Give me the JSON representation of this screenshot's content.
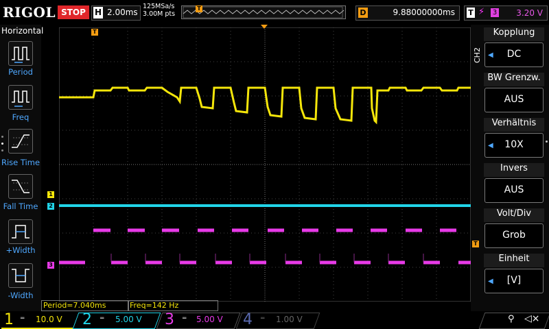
{
  "topbar": {
    "brand": "RIGOL",
    "run_status": "STOP",
    "horizontal_key": "H",
    "timebase": "2.00ms",
    "sample_rate": "125MSa/s",
    "memory_depth": "3.00M pts",
    "delay_key": "D",
    "delay": "9.88000000ms",
    "trigger_key": "T",
    "trigger_source": "3",
    "trigger_level": "3.20 V"
  },
  "left_panel": {
    "title": "Horizontal",
    "items": [
      {
        "label": "Period"
      },
      {
        "label": "Freq"
      },
      {
        "label": "Rise Time"
      },
      {
        "label": "Fall Time"
      },
      {
        "label": "+Width"
      },
      {
        "label": "-Width"
      }
    ]
  },
  "right_panel": {
    "channel_tag": "CH2",
    "items": [
      {
        "title": "Kopplung",
        "value": "DC"
      },
      {
        "title": "BW Grenzw.",
        "value": "AUS"
      },
      {
        "title": "Verhältnis",
        "value": "10X"
      },
      {
        "title": "Invers",
        "value": "AUS"
      },
      {
        "title": "Volt/Div",
        "value": "Grob"
      },
      {
        "title": "Einheit",
        "value": "[V]"
      }
    ]
  },
  "measurements": {
    "period": "Period=7.040ms",
    "freq": "Freq=142 Hz"
  },
  "channels": [
    {
      "num": "1",
      "scale": "10.0 V",
      "color": "#f5e60a"
    },
    {
      "num": "2",
      "scale": "5.00 V",
      "color": "#21d4e8"
    },
    {
      "num": "3",
      "scale": "5.00 V",
      "color": "#e73ae7"
    },
    {
      "num": "4",
      "scale": "1.00 V",
      "color": "#5a6ab0"
    }
  ],
  "markers": {
    "trigger_time": "T",
    "trigger_level": "T",
    "ch1": "1",
    "ch2": "2",
    "ch3": "3"
  }
}
